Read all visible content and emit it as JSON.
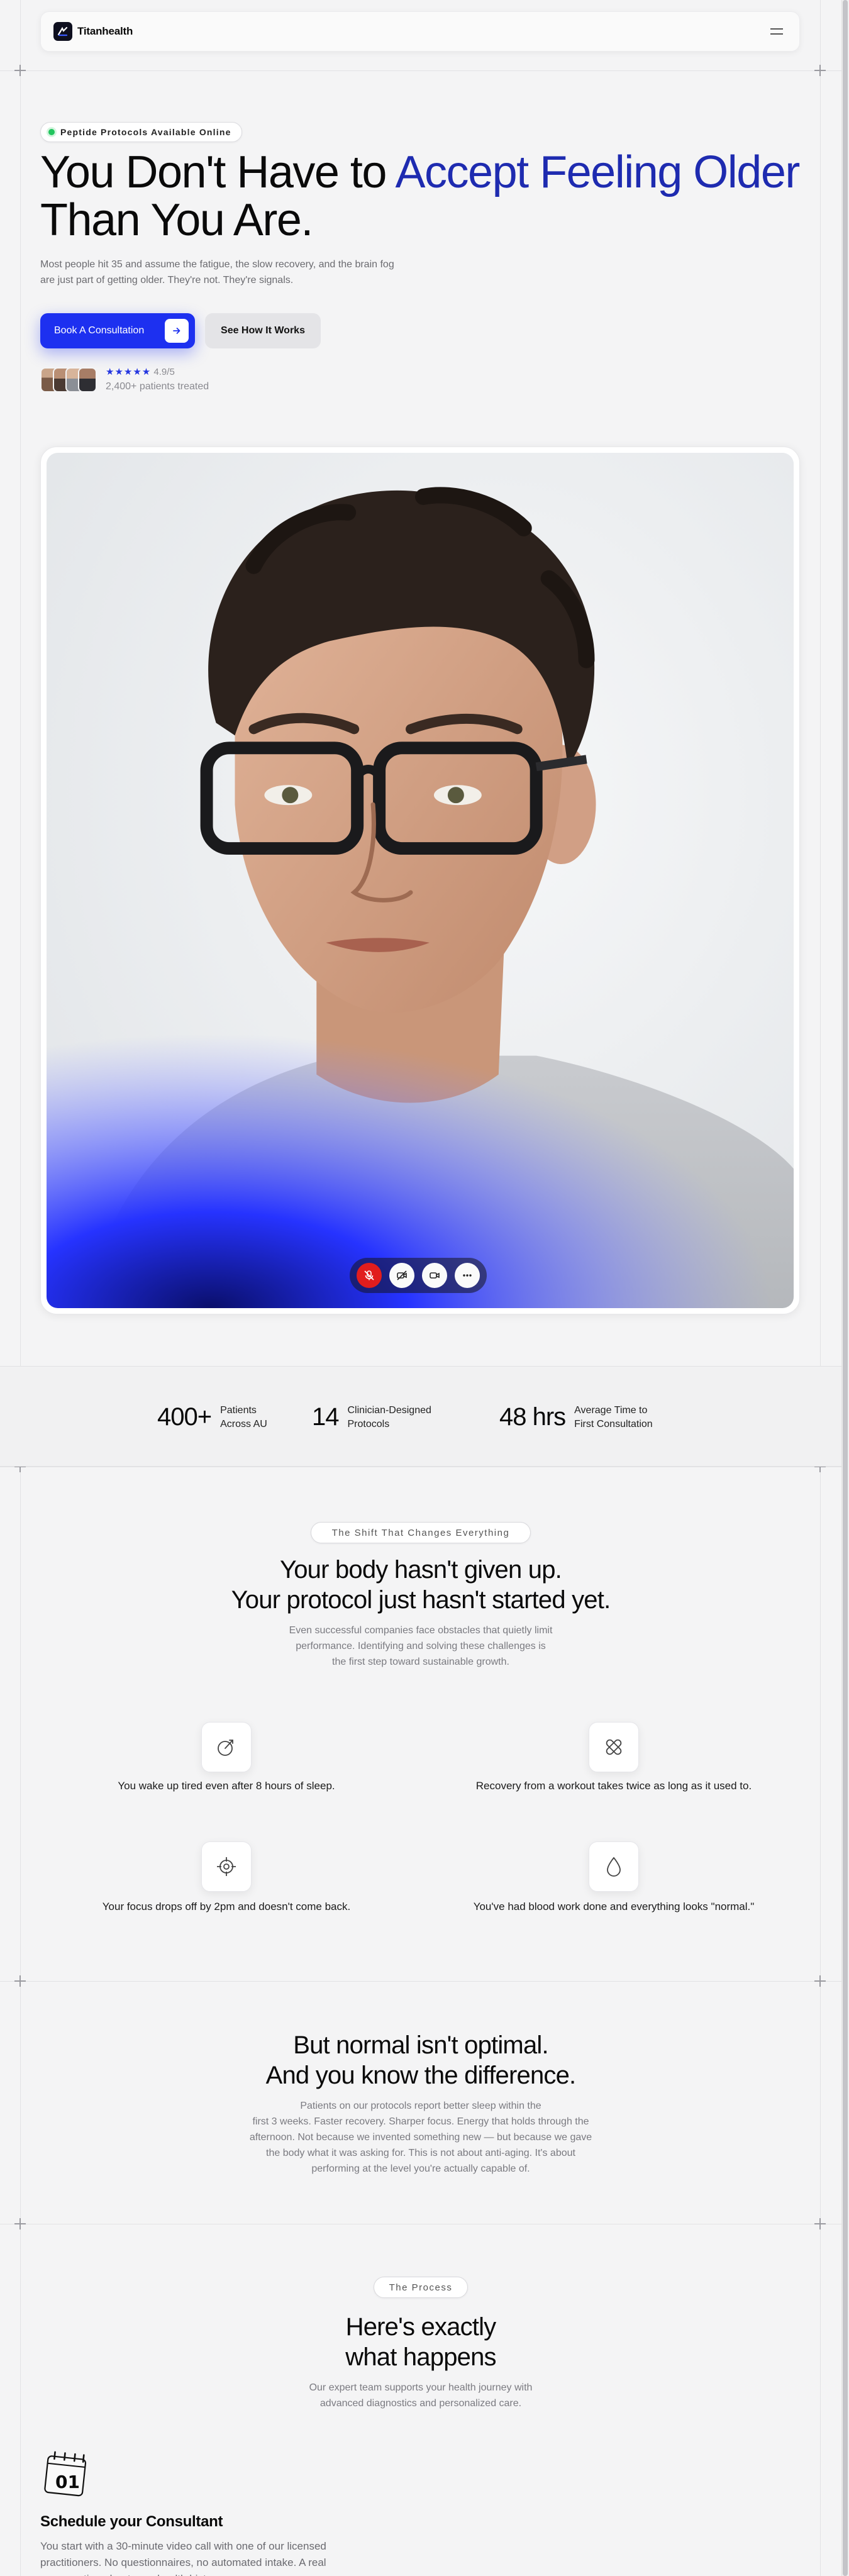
{
  "nav": {
    "brand": "Titanhealth",
    "menu_icon": "menu-icon"
  },
  "hero": {
    "badge": "Peptide Protocols Available Online",
    "title_part1": "You Don't Have to ",
    "title_accent": "Accept Feeling Older",
    "title_part2": "Than You Are.",
    "subtitle": "Most people hit 35 and assume the fatigue, the slow recovery, and the brain fog are just part of getting older. They're not. They're signals.",
    "primary_cta": "Book A Consultation",
    "secondary_cta": "See How It Works",
    "rating_stars": "★★★★★",
    "rating_value": "4.9/5",
    "patients_treated": "2,400+ patients treated"
  },
  "call_controls": [
    "mic-off-icon",
    "camera-off-icon",
    "switch-camera-icon",
    "more-icon"
  ],
  "stats": [
    {
      "value": "400+",
      "label_line1": "Patients",
      "label_line2": "Across AU"
    },
    {
      "value": "14",
      "label_line1": "Clinician-Designed",
      "label_line2": "Protocols"
    },
    {
      "value": "48 hrs",
      "label_line1": "Average Time to",
      "label_line2": "First Consultation"
    }
  ],
  "shift": {
    "tag": "The Shift That Changes Everything",
    "title_line1": "Your body hasn't given up.",
    "title_line2": "Your protocol just hasn't started yet.",
    "sub_line1": "Even successful companies face obstacles that quietly limit",
    "sub_line2": "performance. Identifying and solving these challenges is",
    "sub_line3": "the first step toward sustainable growth.",
    "symptoms": [
      {
        "icon": "compass-icon",
        "text": "You wake up tired even after 8 hours of sleep."
      },
      {
        "icon": "bandage-icon",
        "text": "Recovery from a workout takes twice as long as it used to."
      },
      {
        "icon": "crosshair-icon",
        "text": "Your focus drops off by 2pm and doesn't come back."
      },
      {
        "icon": "drop-icon",
        "text": "You've had blood work done and everything looks \"normal.\""
      }
    ]
  },
  "optimal": {
    "title_line1": "But normal isn't optimal.",
    "title_line2": "And you know the difference.",
    "sub_line1": "Patients on our protocols report better sleep within the",
    "sub_line2": "first 3 weeks. Faster recovery. Sharper focus. Energy that holds through the",
    "sub_line3": "afternoon. Not because we invented something new — but because we gave",
    "sub_line4": "the body what it was asking for. This is not about anti-aging. It's about",
    "sub_line5": "performing at the level you're actually capable of."
  },
  "process": {
    "tag": "The Process",
    "title_line1": "Here's exactly",
    "title_line2": "what happens",
    "sub_line1": "Our expert team supports your health journey with",
    "sub_line2": "advanced diagnostics and personalized care.",
    "step_number": "01",
    "step_title": "Schedule your Consultant",
    "step_text": "You start with a 30-minute video call with one of our licensed practitioners. No questionnaires, no automated intake. A real conversation about your health history, your"
  },
  "colors": {
    "accent": "#1d30f0",
    "accent_text": "#1e2bb0",
    "status_green": "#22c55e",
    "call_red": "#e11d1d"
  }
}
